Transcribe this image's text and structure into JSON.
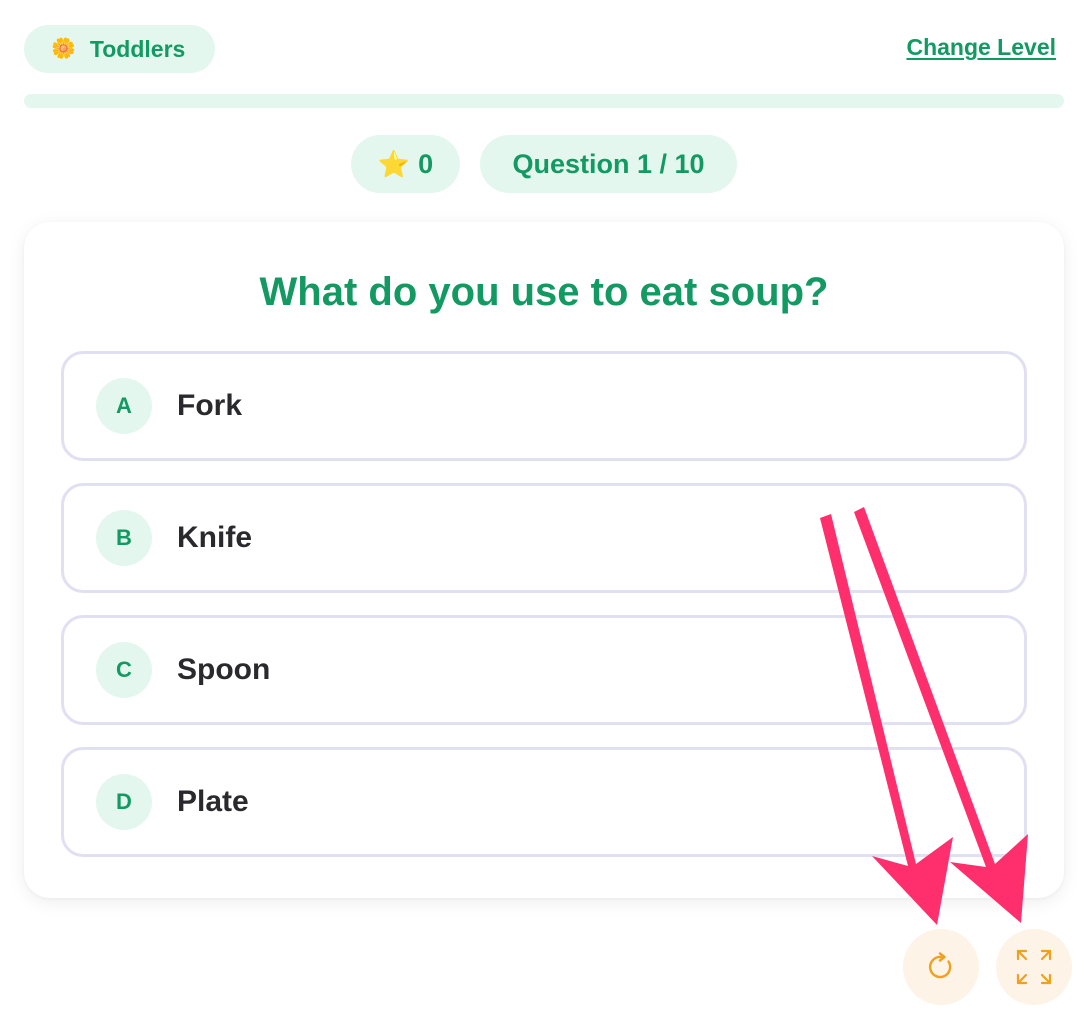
{
  "header": {
    "level_icon": "sun-emoji-icon",
    "level_label": "Toddlers",
    "change_level_label": "Change Level"
  },
  "progress": {
    "fraction": 0.0
  },
  "stats": {
    "stars_icon": "star-icon",
    "stars_count": "0",
    "question_counter": "Question 1 / 10"
  },
  "question": {
    "text": "What do you use to eat soup?",
    "options": [
      {
        "letter": "A",
        "text": "Fork"
      },
      {
        "letter": "B",
        "text": "Knife"
      },
      {
        "letter": "C",
        "text": "Spoon"
      },
      {
        "letter": "D",
        "text": "Plate"
      }
    ]
  },
  "controls": {
    "restart_icon": "restart-icon",
    "fullscreen_icon": "fullscreen-icon"
  },
  "colors": {
    "accent": "#139a63",
    "pill_bg": "#e4f7ee",
    "option_border": "#e1e0f2",
    "control_bg": "#fdf3e6",
    "control_icon": "#f0a020",
    "annotation_arrow": "#ff2f6d"
  }
}
